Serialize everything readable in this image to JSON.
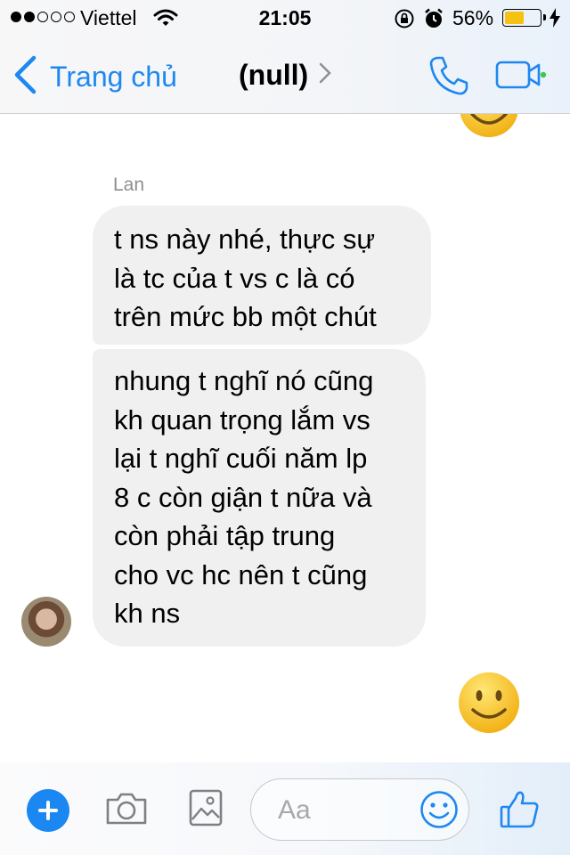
{
  "status_bar": {
    "carrier": "Viettel",
    "time": "21:05",
    "battery_percent": "56%",
    "battery_level": 0.56,
    "signal_bars_filled": 2,
    "signal_bars_total": 5
  },
  "nav": {
    "back_label": "Trang chủ",
    "title": "(null)",
    "icons": [
      "chevron-left-icon",
      "chevron-right-icon",
      "phone-icon",
      "video-camera-icon"
    ]
  },
  "conversation": {
    "sender_name": "Lan",
    "messages": [
      {
        "text": "t ns này nhé, thực sự\nlà tc của t vs c là có\ntrên mức bb một chút"
      },
      {
        "text": "nhung t nghĩ nó cũng\nkh quan trọng lắm vs\nlại t nghĩ cuối năm lp\n8 c còn giận t nữa và\ncòn phải tập trung\ncho vc hc nên t cũng\nkh ns"
      }
    ],
    "emoji_icon": "smiley-face-icon"
  },
  "composer": {
    "placeholder": "Aa",
    "icons": [
      "plus-icon",
      "camera-icon",
      "image-icon",
      "emoji-icon",
      "thumbs-up-icon"
    ]
  },
  "colors": {
    "accent": "#1e88f0",
    "bubble": "#f1f0f0",
    "battery": "#f5c211",
    "emoji_yellow": "#fbd233"
  }
}
